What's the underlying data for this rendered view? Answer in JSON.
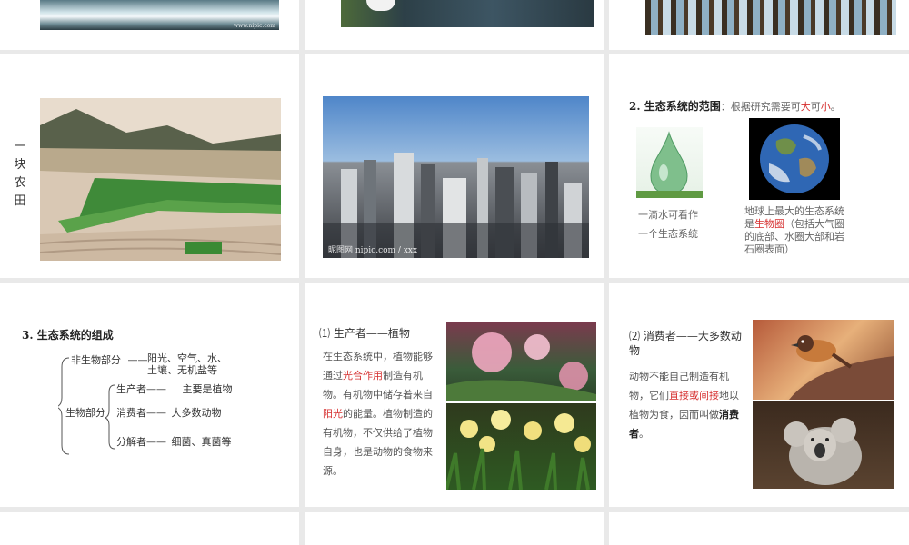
{
  "top_row": {
    "watermark_1": "www.nipic.com"
  },
  "farm_slide": {
    "vertical_label": "一块农田"
  },
  "city_slide": {
    "watermark": "昵图网 nipic.com / xxx"
  },
  "range_slide": {
    "title_bold": "2. 生态系统的范围",
    "title_sep": "：",
    "title_rest_before": "根据研究需要可",
    "title_big": "大",
    "title_mid": "可",
    "title_small": "小",
    "title_end": "。",
    "drop_caption_1": "一滴水可看作",
    "drop_caption_2": "一个生态系统",
    "earth_caption_pre": "地球上最大的生态系统是",
    "earth_caption_red": "生物圈",
    "earth_caption_post": "（包括大气圈的底部、水圈大部和岩石圈表面）"
  },
  "composition_slide": {
    "title": "3. 生态系统的组成",
    "nonbio_label": "非生物部分",
    "nonbio_items_1": "阳光、空气、水、",
    "nonbio_items_2": "土壤、无机盐等",
    "bio_label": "生物部分",
    "producer_label": "生产者——",
    "producer_desc": "主要是植物",
    "consumer_label": "消费者——",
    "consumer_desc": "大多数动物",
    "decomposer_label": "分解者——",
    "decomposer_desc": "细菌、真菌等",
    "dash": "——"
  },
  "producer_slide": {
    "title": "⑴ 生产者——植物",
    "p1": "在生态系统中，植物能够通过",
    "p1_red": "光合作用",
    "p1b": "制造有机物。有机物中储存着来自",
    "p1_red2": "阳光",
    "p1c": "的能量。植物制造的有机物，不仅供给了植物自身，也是动物的食物来源。"
  },
  "consumer_slide": {
    "title": "⑵ 消费者——大多数动物",
    "p1": "动物不能自己制造有机物，它们",
    "p1_red": "直接或间接",
    "p1b": "地以植物为食，因而叫做",
    "p1_bold": "消费者",
    "p1c": "。"
  },
  "colors": {
    "background": "#e9e9e9",
    "slide": "#ffffff",
    "accent_red": "#d63030"
  }
}
